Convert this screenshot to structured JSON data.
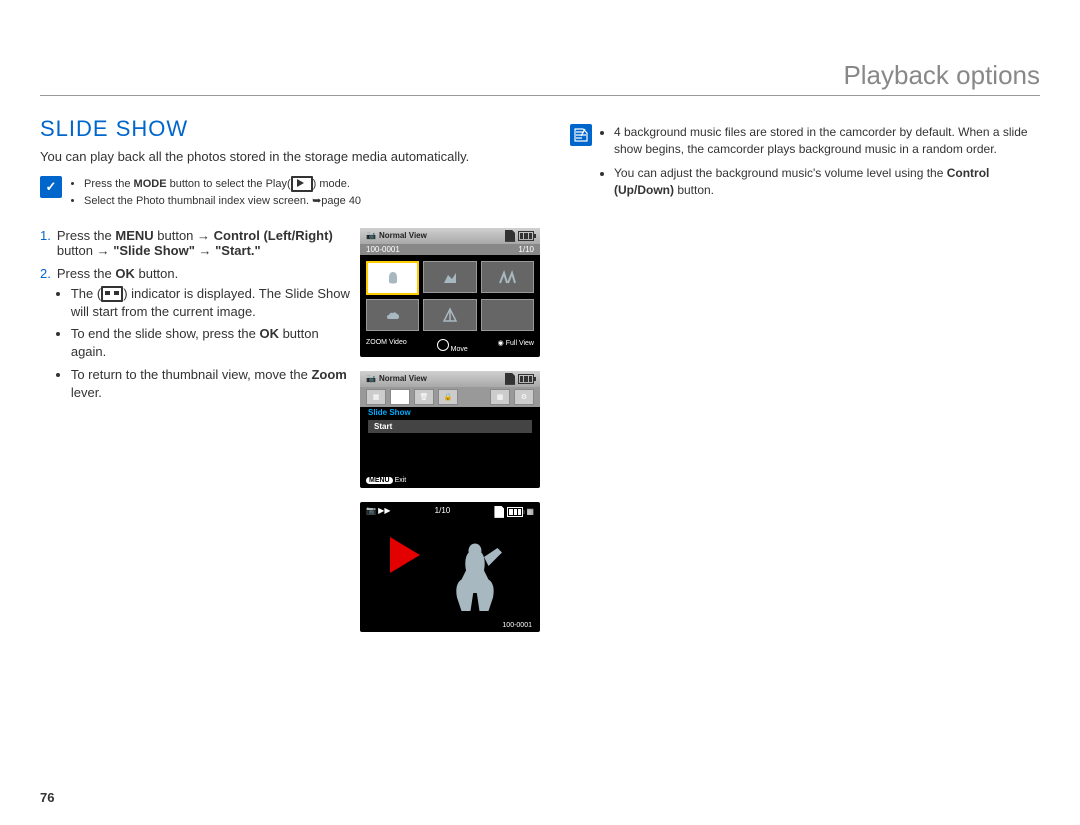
{
  "header": {
    "title": "Playback options"
  },
  "section": {
    "title": "SLIDE SHOW",
    "intro": "You can play back all the photos stored in the storage media automatically."
  },
  "prereq": {
    "items": [
      "Press the MODE button to select the Play( ▶ ) mode.",
      "Select the Photo thumbnail index view screen. ➥page 40"
    ]
  },
  "steps": {
    "s1": {
      "num": "1.",
      "text_a": "Press the ",
      "menu": "MENU",
      "text_b": " button → ",
      "control": "Control (Left/Right)",
      "text_c": " button → ",
      "slideshow": "\"Slide Show\"",
      "text_d": " → ",
      "start": "\"Start.\""
    },
    "s2": {
      "num": "2.",
      "lead_a": "Press the ",
      "ok1": "OK",
      "lead_b": " button.",
      "bullets": {
        "b1_a": "The (",
        "b1_b": ") indicator is displayed. The Slide Show will start from the current image.",
        "b2_a": "To end the slide show, press the ",
        "b2_b": " button again.",
        "ok2": "OK",
        "b3_a": "To return to the thumbnail view, move the ",
        "zoom": "Zoom",
        "b3_b": " lever."
      }
    }
  },
  "screens": {
    "normal_view": "Normal View",
    "folder": "100-0001",
    "count": "1/10",
    "zoom_label": "ZOOM",
    "video": "Video",
    "move": "Move",
    "fullview": "Full View",
    "slideshow": "Slide Show",
    "start": "Start",
    "menu": "MENU",
    "exit": "Exit"
  },
  "notes": {
    "n1": "4 background music files are stored in the camcorder by default. When a slide show begins, the camcorder plays background music in a random order.",
    "n2_a": "You can adjust the background music's volume level using the ",
    "n2_b": "Control (Up/Down)",
    "n2_c": " button."
  },
  "page_number": "76"
}
